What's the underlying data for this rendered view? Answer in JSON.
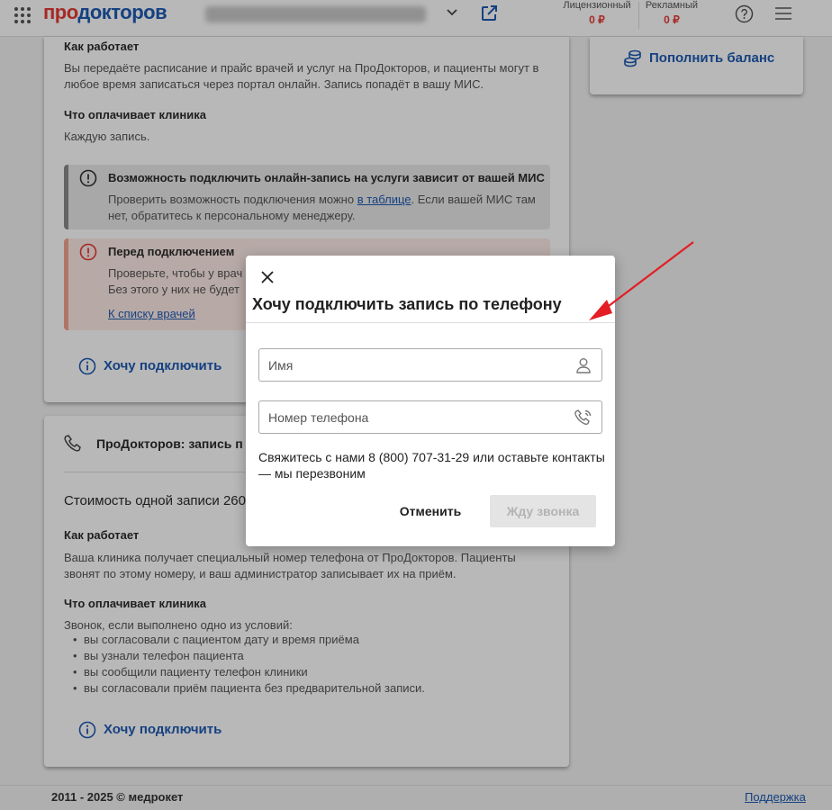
{
  "header": {
    "logo": {
      "part1": "про",
      "part2": "докторов"
    },
    "balances": [
      {
        "label": "Лицензионный",
        "value": "0 ₽"
      },
      {
        "label": "Рекламный",
        "value": "0 ₽"
      }
    ]
  },
  "card1": {
    "how_title": "Как работает",
    "how_text": "Вы передаёте расписание и прайс врачей и услуг на ПроДокторов, и пациенты могут в любое время записаться через портал онлайн. Запись попадёт в вашу МИС.",
    "pay_title": "Что оплачивает клиника",
    "pay_text": "Каждую запись.",
    "alert_gray": {
      "title": "Возможность подключить онлайн-запись на услуги зависит от вашей МИС",
      "text_before": "Проверить возможность подключения можно ",
      "link": "в таблице",
      "text_after": ". Если вашей МИС там нет, обратитесь к персональному менеджеру."
    },
    "alert_red": {
      "title": "Перед подключением",
      "text1": "Проверьте, чтобы у врач",
      "text2": "Без этого у них не будет",
      "link": "К списку врачей"
    },
    "want_button": "Хочу подключить"
  },
  "card2": {
    "title": "ПроДокторов: запись п",
    "cost": "Стоимость одной записи 260",
    "how_title": "Как работает",
    "how_text": "Ваша клиника получает специальный номер телефона от ПроДокторов. Пациенты звонят по этому номеру, и ваш администратор записывает их на приём.",
    "pay_title": "Что оплачивает клиника",
    "pay_intro": "Звонок, если выполнено одно из условий:",
    "bullets": [
      "вы согласовали с пациентом дату и время приёма",
      "вы узнали телефон пациента",
      "вы сообщили пациенту телефон клиники",
      "вы согласовали приём пациента без предварительной записи."
    ],
    "want_button": "Хочу подключить"
  },
  "right": {
    "topup_button": "Пополнить баланс"
  },
  "footer": {
    "copyright": "2011 - 2025 © медрокет",
    "support": "Поддержка"
  },
  "modal": {
    "title": "Хочу подключить запись по телефону",
    "name_placeholder": "Имя",
    "phone_placeholder": "Номер телефона",
    "text": "Свяжитесь с нами 8 (800) 707-31-29 или оставьте контакты — мы перезвоним",
    "cancel": "Отменить",
    "submit": "Жду звонка"
  },
  "colors": {
    "accent": "#1e5ab3",
    "brand_red": "#e53935",
    "arrow": "#e31e24"
  }
}
